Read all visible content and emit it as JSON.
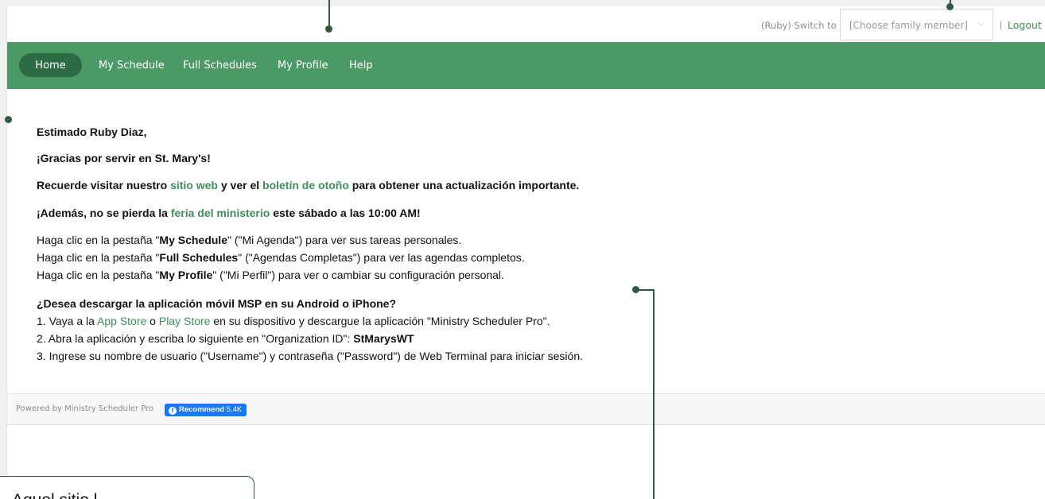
{
  "topbar": {
    "switch_text": "(Ruby) Switch to",
    "family_select_value": "[Choose family member]",
    "separator": "|",
    "logout_label": "Logout"
  },
  "nav": {
    "items": [
      {
        "label": "Home",
        "active": true
      },
      {
        "label": "My Schedule"
      },
      {
        "label": "Full Schedules"
      },
      {
        "label": "My Profile"
      },
      {
        "label": "Help"
      }
    ]
  },
  "content": {
    "greeting": "Estimado Ruby Diaz,",
    "thanks": "¡Gracias por servir en St. Mary's!",
    "visit": {
      "pre": "Recuerde visitar nuestro ",
      "link1": "sitio web",
      "mid": " y ver el ",
      "link2": "boletín de otoño",
      "post": " para obtener una actualización importante."
    },
    "fair": {
      "pre": "¡Además, no se pierda la ",
      "link": "feria del ministerio",
      "post": " este sábado a las 10:00 AM!"
    },
    "tabs_help": [
      {
        "pre": "Haga clic en la pestaña \"",
        "tab": "My Schedule",
        "post": "\" (\"Mi Agenda\") para ver sus tareas personales."
      },
      {
        "pre": "Haga clic en la pestaña \"",
        "tab": "Full Schedules",
        "post": "\" (\"Agendas Completas\") para ver las agendas completos."
      },
      {
        "pre": "Haga clic en la pestaña \"",
        "tab": "My Profile",
        "post": "\" (\"Mi Perfil\") para ver o cambiar su configuración personal."
      }
    ],
    "app_heading": "¿Desea descargar la aplicación móvil MSP en su Android o iPhone?",
    "step1": {
      "pre": "1. Vaya a la ",
      "app_store": "App Store",
      "or": " o ",
      "play_store": "Play Store",
      "post": " en su dispositivo y descargue la aplicación \"Ministry Scheduler Pro\"."
    },
    "step2": {
      "pre": "2. Abra la aplicación y escriba lo siguiente en \"Organization ID\": ",
      "org_id": "StMarysWT"
    },
    "step3": "3. Ingrese su nombre de usuario (\"Username\") y contraseña (\"Password\") de Web Terminal para iniciar sesión."
  },
  "footer": {
    "powered_by": "Powered by Ministry Scheduler Pro",
    "fb_icon": "facebook-icon",
    "recommend_label": "Recommend",
    "recommend_count": "5.4K"
  },
  "callout": {
    "text": "Aquel sitio l"
  },
  "colors": {
    "nav_bg": "#4b9964",
    "nav_active": "#2d6b45",
    "link": "#3d8f5a",
    "annotation": "#2e5a44",
    "facebook": "#1877f2"
  }
}
